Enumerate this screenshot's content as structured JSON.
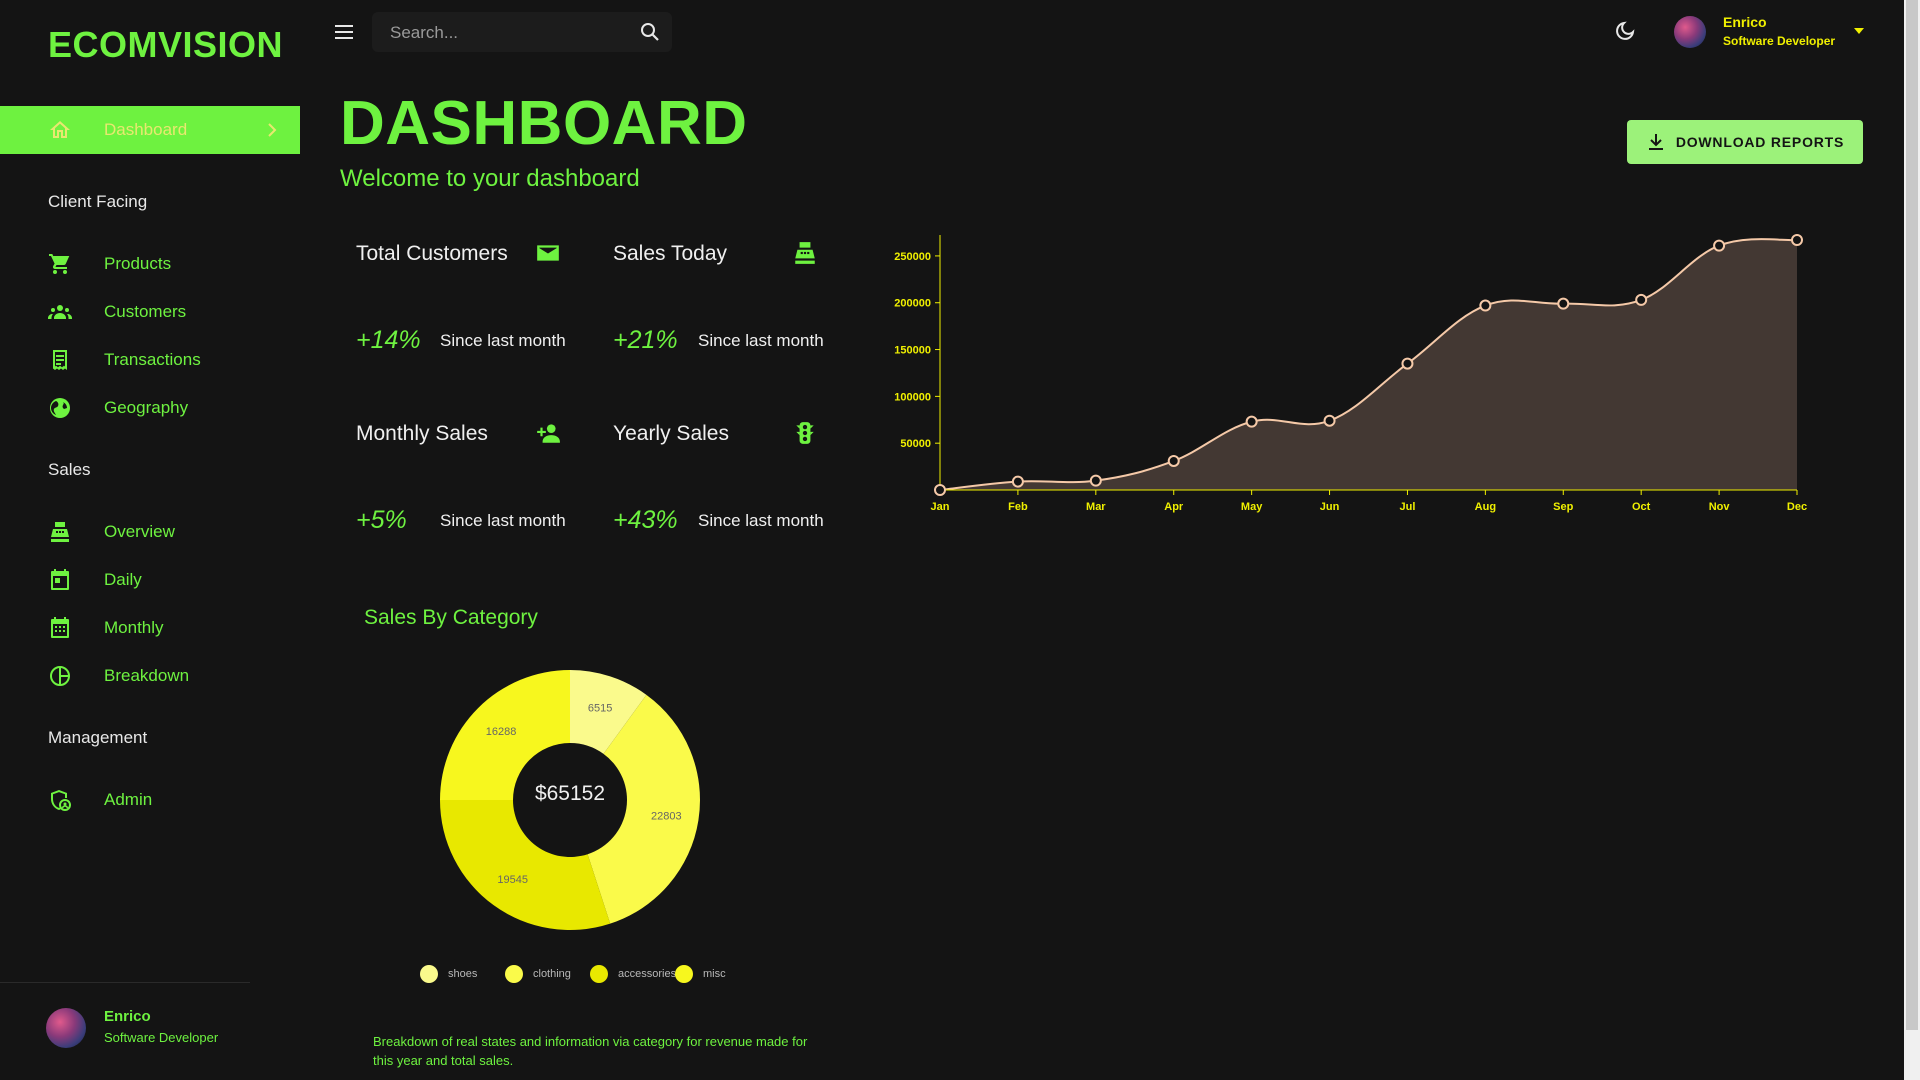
{
  "app": {
    "logo": "ECOMVISION"
  },
  "sidebar": {
    "active": {
      "label": "Dashboard"
    },
    "sections": {
      "client_facing": "Client Facing",
      "sales": "Sales",
      "management": "Management"
    },
    "items": {
      "products": "Products",
      "customers": "Customers",
      "transactions": "Transactions",
      "geography": "Geography",
      "overview": "Overview",
      "daily": "Daily",
      "monthly": "Monthly",
      "breakdown": "Breakdown",
      "admin": "Admin"
    },
    "user": {
      "name": "Enrico",
      "role": "Software Developer"
    }
  },
  "topbar": {
    "search": {
      "placeholder": "Search..."
    },
    "user": {
      "name": "Enrico",
      "role": "Software Developer"
    }
  },
  "header": {
    "title": "DASHBOARD",
    "subtitle": "Welcome to your dashboard",
    "download_label": "DOWNLOAD REPORTS"
  },
  "stats": [
    {
      "title": "Total Customers",
      "increase": "+14%",
      "since": "Since last month",
      "icon": "email-icon"
    },
    {
      "title": "Sales Today",
      "increase": "+21%",
      "since": "Since last month",
      "icon": "point-of-sale-icon"
    },
    {
      "title": "Monthly Sales",
      "increase": "+5%",
      "since": "Since last month",
      "icon": "person-add-icon"
    },
    {
      "title": "Yearly Sales",
      "increase": "+43%",
      "since": "Since last month",
      "icon": "traffic-icon"
    }
  ],
  "category": {
    "title": "Sales By Category",
    "total": "$65152",
    "description": "Breakdown of real states and information via category for revenue made for this year and total sales."
  },
  "colors": {
    "accent": "#6ef240",
    "background": "#141414",
    "line": "#f5c9a8",
    "area": "#433833",
    "axis": "#f0f000"
  },
  "chart_data": [
    {
      "type": "area",
      "x": [
        "Jan",
        "Feb",
        "Mar",
        "Apr",
        "May",
        "Jun",
        "Jul",
        "Aug",
        "Sep",
        "Oct",
        "Nov",
        "Dec"
      ],
      "values": [
        0,
        9000,
        10000,
        31000,
        73000,
        74000,
        135000,
        197000,
        199000,
        203000,
        261000,
        267000
      ],
      "yticks": [
        50000,
        100000,
        150000,
        200000,
        250000
      ],
      "ylim": [
        0,
        267000
      ],
      "grid": false
    },
    {
      "type": "pie",
      "categories": [
        "shoes",
        "clothing",
        "accessories",
        "misc"
      ],
      "values": [
        6515,
        22803,
        19545,
        16288
      ],
      "colors": [
        "#fafa8c",
        "#fafa4a",
        "#e8e800",
        "#f7f71e"
      ],
      "legend": "bottom"
    }
  ]
}
